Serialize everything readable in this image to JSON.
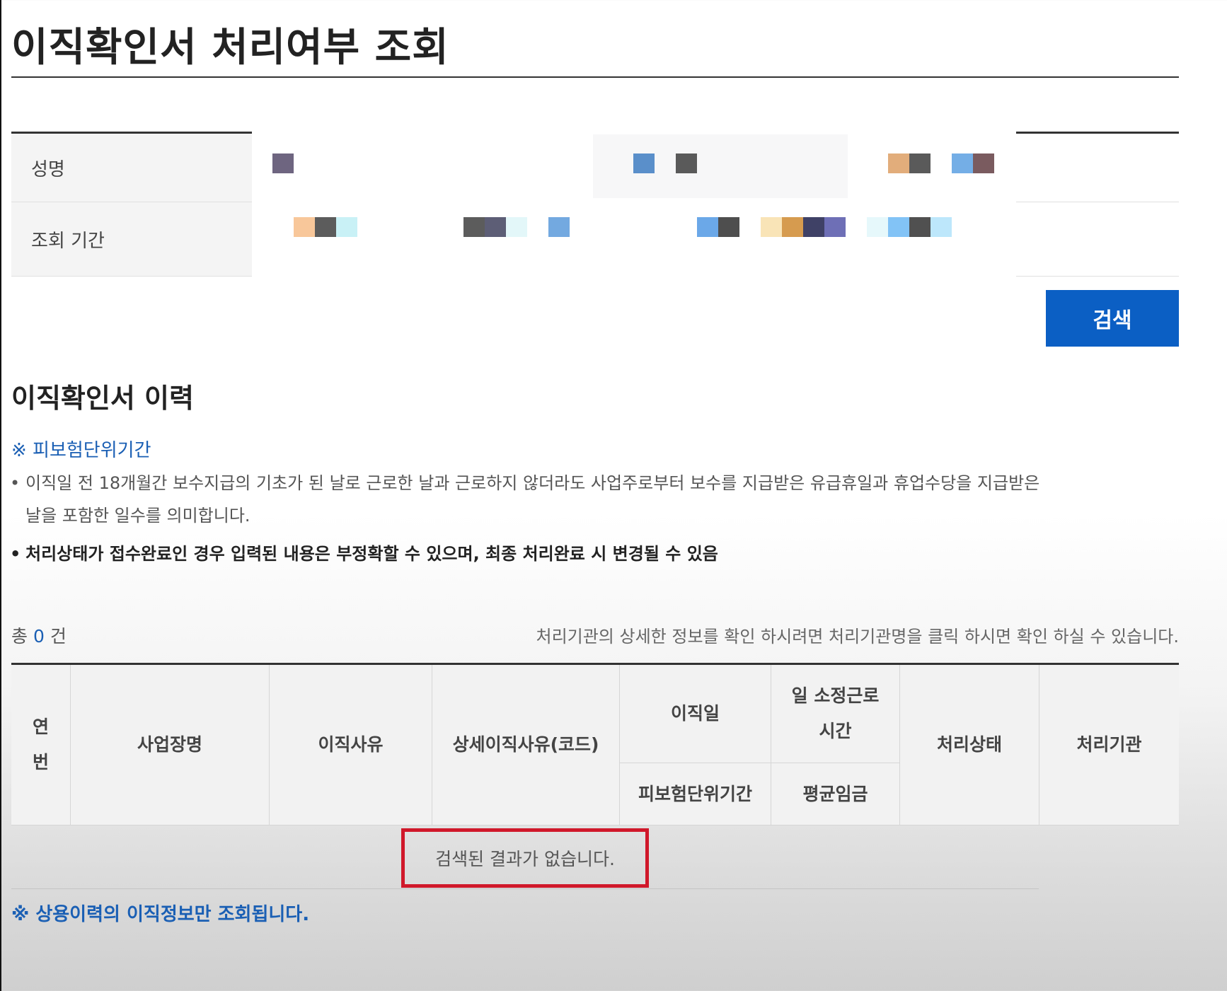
{
  "page": {
    "title": "이직확인서 처리여부 조회"
  },
  "search_form": {
    "name_label": "성명",
    "period_label": "조회 기간",
    "search_button": "검색"
  },
  "history": {
    "title": "이직확인서 이력",
    "note_link": "※ 피보험단위기간",
    "bullet_symbol": "•",
    "desc_line1": "이직일 전 18개월간 보수지급의 기초가 된 날로 근로한 날과 근로하지 않더라도 사업주로부터 보수를 지급받은 유급휴일과 휴업수당을 지급받은",
    "desc_line2": "날을 포함한 일수를 의미합니다.",
    "desc_bold": "처리상태가 접수완료인 경우 입력된 내용은 부정확할 수 있으며, 최종 처리완료 시 변경될 수 있음",
    "count_prefix": "총",
    "count_value": "0",
    "count_suffix": "건",
    "hint": "처리기관의 상세한 정보를 확인 하시려면 처리기관명을 클릭 하시면 확인 하실 수 있습니다."
  },
  "table": {
    "headers": {
      "seq_1": "연",
      "seq_2": "번",
      "workplace": "사업장명",
      "reason": "이직사유",
      "detail_reason": "상세이직사유(코드)",
      "leave_date": "이직일",
      "work_hours_1": "일 소정근로",
      "work_hours_2": "시간",
      "insured_period": "피보험단위기간",
      "avg_wage": "평균임금",
      "status": "처리상태",
      "agency": "처리기관"
    },
    "empty_message": "검색된 결과가 없습니다."
  },
  "footer_note": "※ 상용이력의 이직정보만 조회됩니다.",
  "colors": {
    "accent_blue": "#0b5fc4",
    "link_blue": "#1a5fb4",
    "highlight_red": "#d0182a"
  }
}
